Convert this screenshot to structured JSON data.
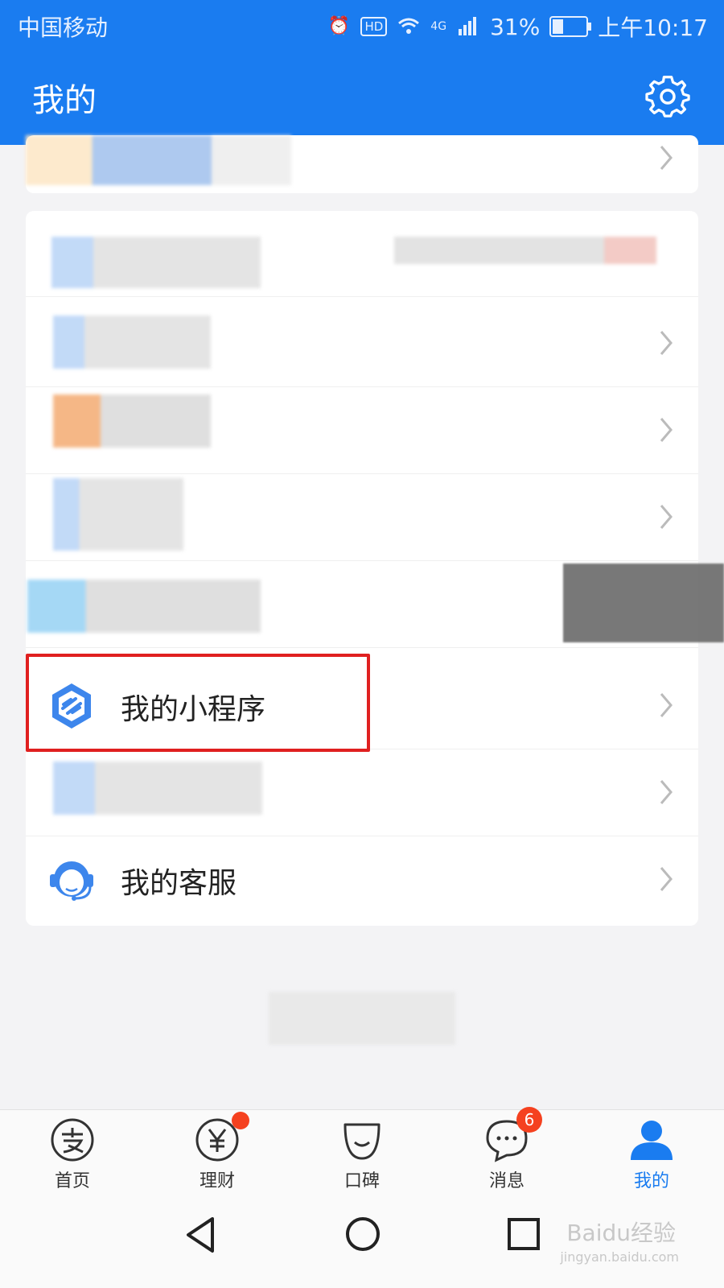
{
  "status_bar": {
    "carrier": "中国移动",
    "network": "4G",
    "battery": "31%",
    "time": "上午10:17",
    "hd": "HD"
  },
  "header": {
    "title": "我的"
  },
  "menu": {
    "mini_programs": "我的小程序",
    "customer_service": "我的客服"
  },
  "tabs": [
    {
      "label": "首页",
      "icon": "alipay-home-icon"
    },
    {
      "label": "理财",
      "icon": "yen-icon"
    },
    {
      "label": "口碑",
      "icon": "koubei-icon"
    },
    {
      "label": "消息",
      "icon": "chat-bubble-icon",
      "badge": "6"
    },
    {
      "label": "我的",
      "icon": "person-icon"
    }
  ],
  "watermark": {
    "brand": "Baidu经验",
    "url": "jingyan.baidu.com"
  },
  "colors": {
    "brand": "#1a7cf0",
    "highlight": "#e02020",
    "badge": "#f5411f"
  }
}
